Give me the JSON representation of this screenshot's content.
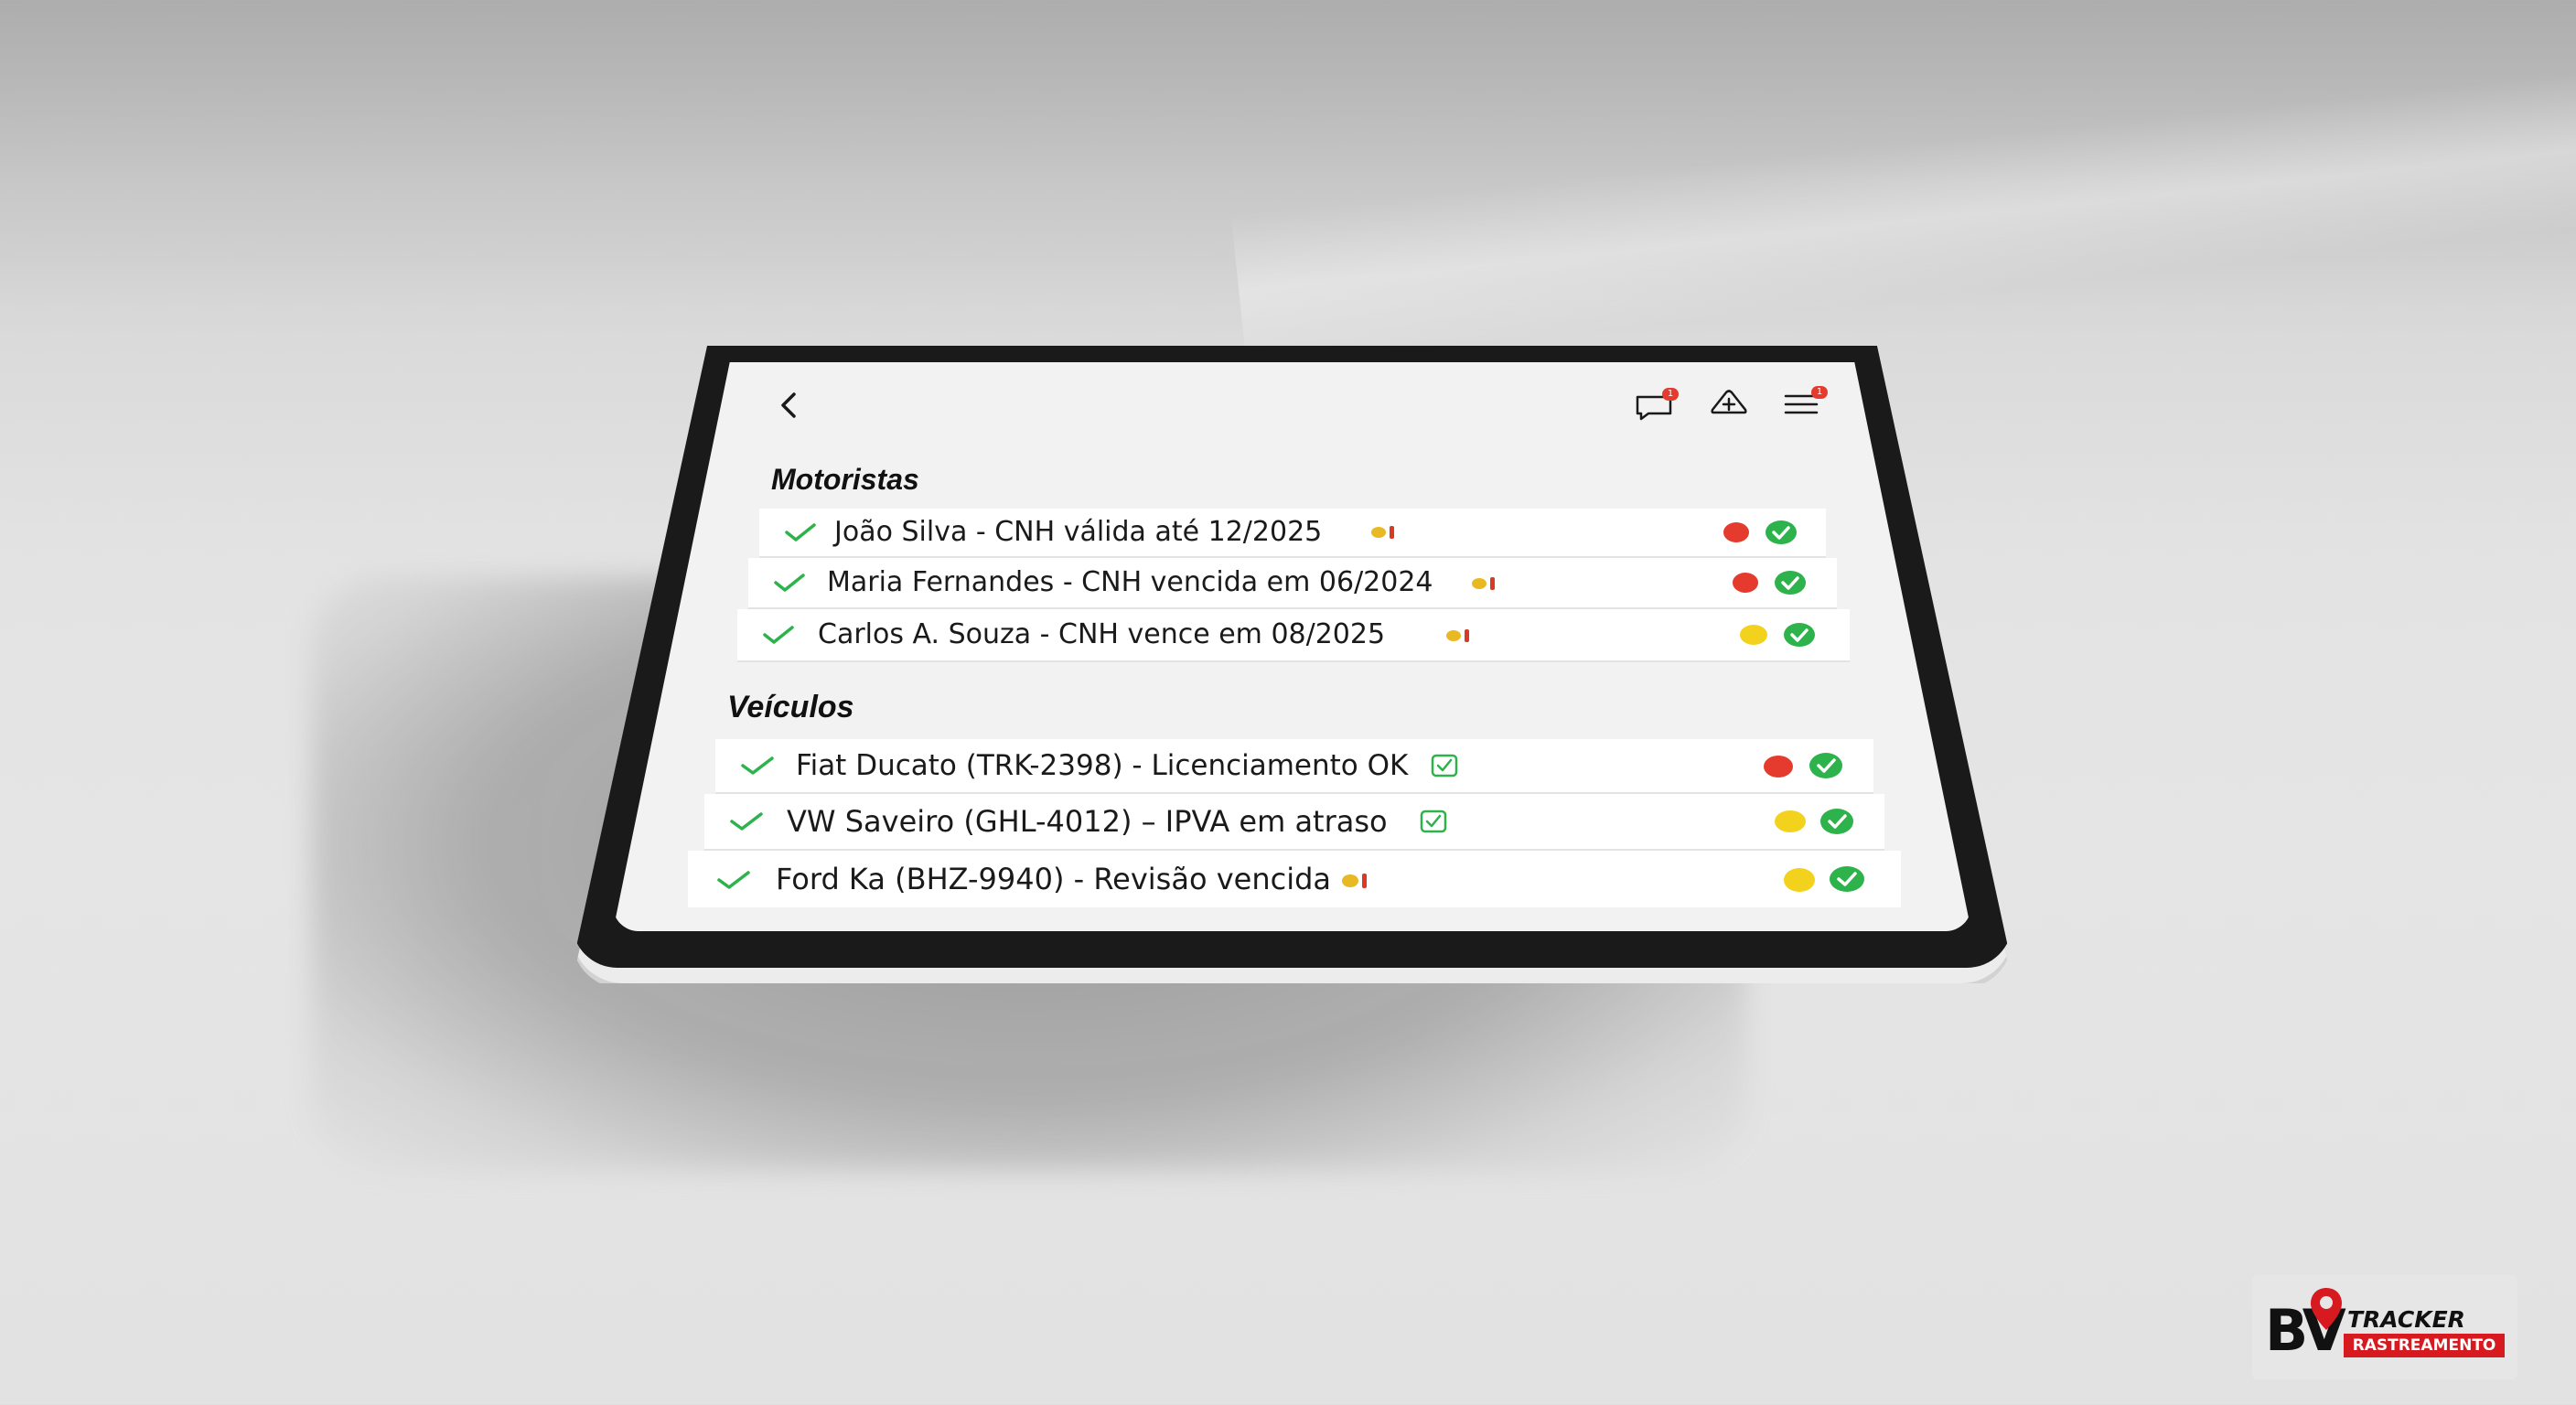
{
  "header": {
    "back_icon": "chevron-left-icon",
    "message_icon": "message-icon",
    "message_badge": "1",
    "alert_icon": "alert-icon",
    "menu_icon": "hamburger-menu-icon",
    "menu_badge": "1"
  },
  "motoristas": {
    "title": "Motoristas",
    "rows": [
      {
        "text": "João Silva - CNH válida até 12/2025",
        "tag": "warning-tag-icon",
        "status": "red"
      },
      {
        "text": "Maria Fernandes - CNH vencida em 06/2024",
        "tag": "warning-tag-icon",
        "status": "red"
      },
      {
        "text": "Carlos A. Souza - CNH vence em 08/2025",
        "tag": "warning-tag-icon",
        "status": "yellow"
      }
    ]
  },
  "veiculos": {
    "title": "Veículos",
    "rows": [
      {
        "text": "Fiat Ducato (TRK-2398) - Licenciamento OK",
        "tag": "checkbox-icon",
        "status": "red"
      },
      {
        "text": "VW Saveiro (GHL-4012) – IPVA em atraso",
        "tag": "checkbox-icon",
        "status": "yellow"
      },
      {
        "text": "Ford Ka (BHZ-9940) - Revisão vencida",
        "tag": "warning-tag-icon",
        "status": "yellow"
      }
    ]
  },
  "colors": {
    "red": "#e53a2e",
    "yellow": "#f2d21c",
    "green": "#2eb24c",
    "brand_red": "#d71920"
  },
  "logo": {
    "initials": "BV",
    "line1": "TRACKER",
    "line2": "RASTREAMENTO"
  }
}
